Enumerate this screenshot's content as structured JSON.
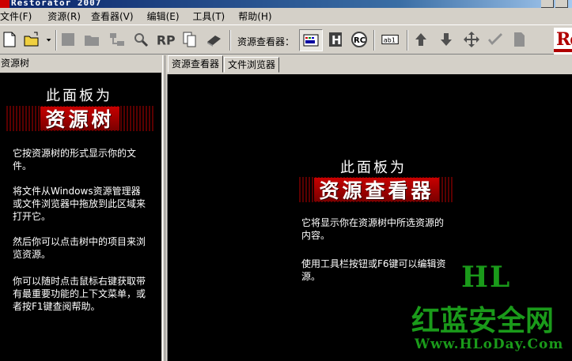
{
  "window": {
    "title": "Restorator 2007"
  },
  "menu": [
    "文件(F)",
    "资源(R)",
    "查看器(V)",
    "编辑(E)",
    "工具(T)",
    "帮助(H)"
  ],
  "toolbar": {
    "viewer_label": "资源查看器：",
    "logo_text": "Re"
  },
  "tree_panel": {
    "header": "资源树",
    "heading": "此面板为",
    "banner": "资源树",
    "paragraphs": [
      "它按资源树的形式显示你的文件。",
      "将文件从Windows资源管理器或文件浏览器中拖放到此区域来打开它。",
      "然后你可以点击树中的项目来浏览资源。",
      "你可以随时点击鼠标右键获取带有最重要功能的上下文菜单，或者按F1键查阅帮助。"
    ]
  },
  "viewer_panel": {
    "tabs": [
      "资源查看器",
      "文件浏览器"
    ],
    "heading": "此面板为",
    "banner": "资源查看器",
    "paragraphs": [
      "它将显示你在资源树中所选资源的内容。",
      "使用工具栏按钮或F6键可以编辑资源。"
    ]
  },
  "watermark": {
    "brand": "HL",
    "name": "红蓝安全网",
    "url": "Www.HLoDay.Com"
  }
}
